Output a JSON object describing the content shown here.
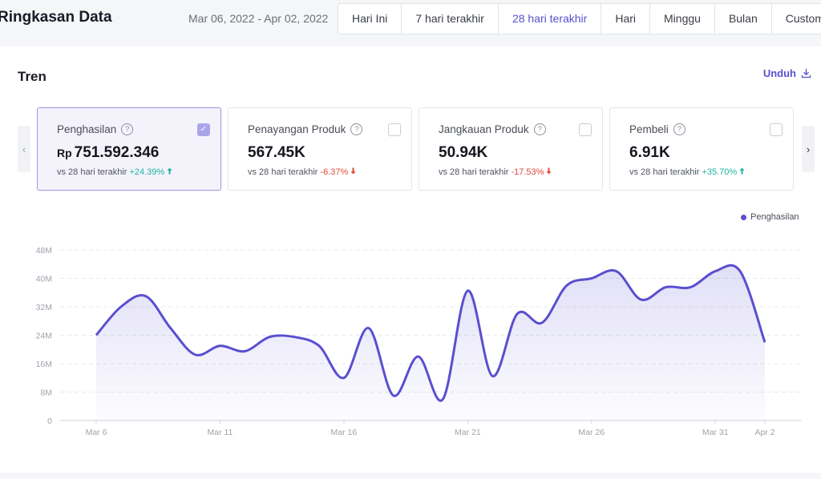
{
  "header": {
    "title": "Ringkasan Data",
    "date_range": "Mar 06, 2022 - Apr 02, 2022",
    "filters": [
      {
        "label": "Hari Ini",
        "active": false
      },
      {
        "label": "7 hari terakhir",
        "active": false
      },
      {
        "label": "28 hari terakhir",
        "active": true
      },
      {
        "label": "Hari",
        "active": false
      },
      {
        "label": "Minggu",
        "active": false
      },
      {
        "label": "Bulan",
        "active": false
      },
      {
        "label": "Custom",
        "active": false
      }
    ]
  },
  "trend": {
    "title": "Tren",
    "download_label": "Unduh",
    "prev_icon": "‹",
    "next_icon": "›",
    "cards": [
      {
        "label": "Penghasilan",
        "currency": "Rp",
        "value": "751.592.346",
        "compare": "vs 28 hari terakhir",
        "delta": "+24.39%",
        "direction": "up",
        "selected": true
      },
      {
        "label": "Penayangan Produk",
        "currency": "",
        "value": "567.45K",
        "compare": "vs 28 hari terakhir",
        "delta": "-6.37%",
        "direction": "down",
        "selected": false
      },
      {
        "label": "Jangkauan Produk",
        "currency": "",
        "value": "50.94K",
        "compare": "vs 28 hari terakhir",
        "delta": "-17.53%",
        "direction": "down",
        "selected": false
      },
      {
        "label": "Pembeli",
        "currency": "",
        "value": "6.91K",
        "compare": "vs 28 hari terakhir",
        "delta": "+35.70%",
        "direction": "up",
        "selected": false
      }
    ],
    "colors": {
      "accent": "#5a4fcf",
      "up": "#1db5a0",
      "down": "#e0473a"
    }
  },
  "chart_data": {
    "type": "area",
    "series": [
      {
        "name": "Penghasilan",
        "color": "#5a4fcf",
        "values": [
          24,
          32,
          35,
          26,
          18.5,
          21,
          19.5,
          23.5,
          23.5,
          21,
          12,
          26,
          7,
          18,
          6,
          36.5,
          12.5,
          30,
          27.5,
          38,
          40,
          42,
          34,
          37.5,
          37.5,
          42,
          42,
          22
        ]
      }
    ],
    "x": [
      "Mar 6",
      "Mar 7",
      "Mar 8",
      "Mar 9",
      "Mar 10",
      "Mar 11",
      "Mar 12",
      "Mar 13",
      "Mar 14",
      "Mar 15",
      "Mar 16",
      "Mar 17",
      "Mar 18",
      "Mar 19",
      "Mar 20",
      "Mar 21",
      "Mar 22",
      "Mar 23",
      "Mar 24",
      "Mar 25",
      "Mar 26",
      "Mar 27",
      "Mar 28",
      "Mar 29",
      "Mar 30",
      "Mar 31",
      "Apr 1",
      "Apr 2"
    ],
    "xtick_labels": [
      "Mar 6",
      "Mar 11",
      "Mar 16",
      "Mar 21",
      "Mar 26",
      "Mar 31",
      "Apr 2"
    ],
    "y_ticks": [
      0,
      8,
      16,
      24,
      32,
      40,
      48
    ],
    "ytick_labels": [
      "0",
      "8M",
      "16M",
      "24M",
      "32M",
      "40M",
      "48M"
    ],
    "ylim": [
      0,
      48
    ],
    "legend_position": "top-right",
    "grid": true
  }
}
